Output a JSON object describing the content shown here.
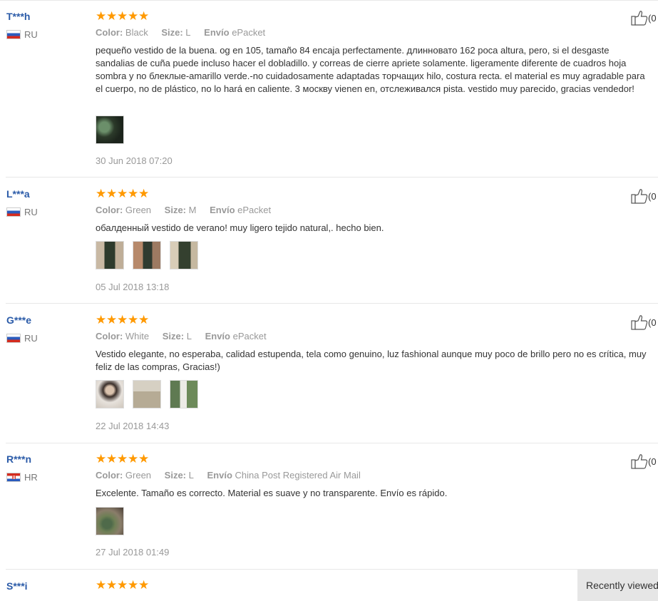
{
  "labels": {
    "color": "Color:",
    "size": "Size:",
    "envio": "Envío"
  },
  "likes_count": "(0",
  "recently_viewed": "Recently viewed",
  "reviews": [
    {
      "user": "T***h",
      "country": "RU",
      "stars": 5,
      "color": "Black",
      "size": "L",
      "shipping": "ePacket",
      "text": "pequeño vestido de la buena. og en 105, tamaño 84 encaja perfectamente. длинновато 162 poca altura, pero, si el desgaste sandalias de cuña puede incluso hacer el dobladillo. y correas de cierre apriete solamente. ligeramente diferente de cuadros hoja sombra y no блеклые-amarillo verde.-no cuidadosamente adaptadas торчащих hilo, costura recta. el material es muy agradable para el cuerpo, no de plástico, no lo hará en caliente. 3 москву vienen en, отслеживался pista. vestido muy parecido, gracias vendedor!",
      "photos": 1,
      "date": "30 Jun 2018 07:20"
    },
    {
      "user": "L***a",
      "country": "RU",
      "stars": 5,
      "color": "Green",
      "size": "M",
      "shipping": "ePacket",
      "text": "обалденный vestido de verano! muy ligero tejido natural,. hecho bien.",
      "photos": 3,
      "date": "05 Jul 2018 13:18"
    },
    {
      "user": "G***e",
      "country": "RU",
      "stars": 5,
      "color": "White",
      "size": "L",
      "shipping": "ePacket",
      "text": "Vestido elegante, no esperaba, calidad estupenda, tela como genuino, luz fashional aunque muy poco de brillo pero no es crítica, muy feliz de las compras, Gracias!)",
      "photos": 3,
      "date": "22 Jul 2018 14:43"
    },
    {
      "user": "R***n",
      "country": "HR",
      "stars": 5,
      "color": "Green",
      "size": "L",
      "shipping": "China Post Registered Air Mail",
      "text": "Excelente. Tamaño es correcto. Material es suave y no transparente. Envío es rápido.",
      "photos": 1,
      "date": "27 Jul 2018 01:49"
    },
    {
      "user": "S***i",
      "stars": 5
    }
  ]
}
